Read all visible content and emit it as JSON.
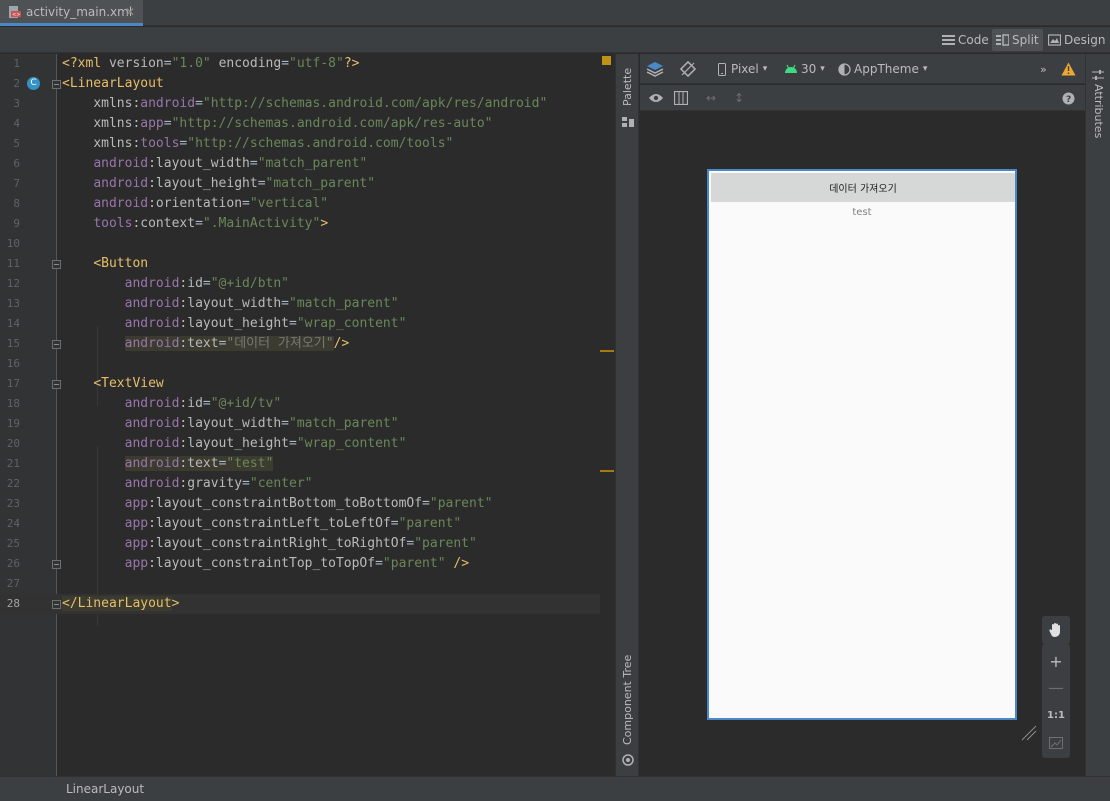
{
  "tab": {
    "filename": "activity_main.xml"
  },
  "modes": {
    "code": "Code",
    "split": "Split",
    "design": "Design",
    "active": "split"
  },
  "editor": {
    "current_line": 28,
    "lines": [
      {
        "n": "1",
        "parts": [
          [
            "c-tag",
            "<?xml "
          ],
          [
            "c-attr",
            "version"
          ],
          [
            "c-plain",
            "="
          ],
          [
            "c-str",
            "\"1.0\""
          ],
          [
            "c-plain",
            " "
          ],
          [
            "c-attr",
            "encoding"
          ],
          [
            "c-plain",
            "="
          ],
          [
            "c-str",
            "\"utf-8\""
          ],
          [
            "c-tag",
            "?>"
          ]
        ]
      },
      {
        "n": "2",
        "parts": [
          [
            "c-tag",
            "<LinearLayout"
          ]
        ]
      },
      {
        "n": "3",
        "parts": [
          [
            "c-plain",
            "    "
          ],
          [
            "c-attr",
            "xmlns:"
          ],
          [
            "c-ns",
            "android"
          ],
          [
            "c-plain",
            "="
          ],
          [
            "c-str",
            "\"http://schemas.android.com/apk/res/android\""
          ]
        ]
      },
      {
        "n": "4",
        "parts": [
          [
            "c-plain",
            "    "
          ],
          [
            "c-attr",
            "xmlns:"
          ],
          [
            "c-ns",
            "app"
          ],
          [
            "c-plain",
            "="
          ],
          [
            "c-str",
            "\"http://schemas.android.com/apk/res-auto\""
          ]
        ]
      },
      {
        "n": "5",
        "parts": [
          [
            "c-plain",
            "    "
          ],
          [
            "c-attr",
            "xmlns:"
          ],
          [
            "c-ns",
            "tools"
          ],
          [
            "c-plain",
            "="
          ],
          [
            "c-str",
            "\"http://schemas.android.com/tools\""
          ]
        ]
      },
      {
        "n": "6",
        "parts": [
          [
            "c-plain",
            "    "
          ],
          [
            "c-ns",
            "android"
          ],
          [
            "c-attr",
            ":layout_width"
          ],
          [
            "c-plain",
            "="
          ],
          [
            "c-str",
            "\"match_parent\""
          ]
        ]
      },
      {
        "n": "7",
        "parts": [
          [
            "c-plain",
            "    "
          ],
          [
            "c-ns",
            "android"
          ],
          [
            "c-attr",
            ":layout_height"
          ],
          [
            "c-plain",
            "="
          ],
          [
            "c-str",
            "\"match_parent\""
          ]
        ]
      },
      {
        "n": "8",
        "parts": [
          [
            "c-plain",
            "    "
          ],
          [
            "c-ns",
            "android"
          ],
          [
            "c-attr",
            ":orientation"
          ],
          [
            "c-plain",
            "="
          ],
          [
            "c-str",
            "\"vertical\""
          ]
        ]
      },
      {
        "n": "9",
        "parts": [
          [
            "c-plain",
            "    "
          ],
          [
            "c-ns",
            "tools"
          ],
          [
            "c-attr",
            ":context"
          ],
          [
            "c-plain",
            "="
          ],
          [
            "c-str",
            "\".MainActivity\""
          ],
          [
            "c-tag",
            ">"
          ]
        ]
      },
      {
        "n": "10",
        "parts": []
      },
      {
        "n": "11",
        "parts": [
          [
            "c-plain",
            "    "
          ],
          [
            "c-tag",
            "<Button"
          ]
        ]
      },
      {
        "n": "12",
        "parts": [
          [
            "c-plain",
            "        "
          ],
          [
            "c-ns",
            "android"
          ],
          [
            "c-attr",
            ":id"
          ],
          [
            "c-plain",
            "="
          ],
          [
            "c-str",
            "\"@+id/btn\""
          ]
        ]
      },
      {
        "n": "13",
        "parts": [
          [
            "c-plain",
            "        "
          ],
          [
            "c-ns",
            "android"
          ],
          [
            "c-attr",
            ":layout_width"
          ],
          [
            "c-plain",
            "="
          ],
          [
            "c-str",
            "\"match_parent\""
          ]
        ]
      },
      {
        "n": "14",
        "parts": [
          [
            "c-plain",
            "        "
          ],
          [
            "c-ns",
            "android"
          ],
          [
            "c-attr",
            ":layout_height"
          ],
          [
            "c-plain",
            "="
          ],
          [
            "c-str",
            "\"wrap_content\""
          ]
        ]
      },
      {
        "n": "15",
        "parts": [
          [
            "c-plain",
            "        "
          ],
          [
            "c-ns c-hl",
            "android"
          ],
          [
            "c-attr c-hl",
            ":text"
          ],
          [
            "c-plain c-hl",
            "="
          ],
          [
            "c-hint c-hl",
            "\"데이터 가져오기\""
          ],
          [
            "c-tag",
            "/>"
          ]
        ]
      },
      {
        "n": "16",
        "parts": []
      },
      {
        "n": "17",
        "parts": [
          [
            "c-plain",
            "    "
          ],
          [
            "c-tag",
            "<TextView"
          ]
        ]
      },
      {
        "n": "18",
        "parts": [
          [
            "c-plain",
            "        "
          ],
          [
            "c-ns",
            "android"
          ],
          [
            "c-attr",
            ":id"
          ],
          [
            "c-plain",
            "="
          ],
          [
            "c-str",
            "\"@+id/tv\""
          ]
        ]
      },
      {
        "n": "19",
        "parts": [
          [
            "c-plain",
            "        "
          ],
          [
            "c-ns",
            "android"
          ],
          [
            "c-attr",
            ":layout_width"
          ],
          [
            "c-plain",
            "="
          ],
          [
            "c-str",
            "\"match_parent\""
          ]
        ]
      },
      {
        "n": "20",
        "parts": [
          [
            "c-plain",
            "        "
          ],
          [
            "c-ns",
            "android"
          ],
          [
            "c-attr",
            ":layout_height"
          ],
          [
            "c-plain",
            "="
          ],
          [
            "c-str",
            "\"wrap_content\""
          ]
        ]
      },
      {
        "n": "21",
        "parts": [
          [
            "c-plain",
            "        "
          ],
          [
            "c-ns c-hl",
            "android"
          ],
          [
            "c-attr c-hl",
            ":text"
          ],
          [
            "c-plain c-hl",
            "="
          ],
          [
            "c-str c-hl",
            "\"test\""
          ]
        ]
      },
      {
        "n": "22",
        "parts": [
          [
            "c-plain",
            "        "
          ],
          [
            "c-ns",
            "android"
          ],
          [
            "c-attr",
            ":gravity"
          ],
          [
            "c-plain",
            "="
          ],
          [
            "c-str",
            "\"center\""
          ]
        ]
      },
      {
        "n": "23",
        "parts": [
          [
            "c-plain",
            "        "
          ],
          [
            "c-ns",
            "app"
          ],
          [
            "c-attr",
            ":layout_constraintBottom_toBottomOf"
          ],
          [
            "c-plain",
            "="
          ],
          [
            "c-str",
            "\"parent\""
          ]
        ]
      },
      {
        "n": "24",
        "parts": [
          [
            "c-plain",
            "        "
          ],
          [
            "c-ns",
            "app"
          ],
          [
            "c-attr",
            ":layout_constraintLeft_toLeftOf"
          ],
          [
            "c-plain",
            "="
          ],
          [
            "c-str",
            "\"parent\""
          ]
        ]
      },
      {
        "n": "25",
        "parts": [
          [
            "c-plain",
            "        "
          ],
          [
            "c-ns",
            "app"
          ],
          [
            "c-attr",
            ":layout_constraintRight_toRightOf"
          ],
          [
            "c-plain",
            "="
          ],
          [
            "c-str",
            "\"parent\""
          ]
        ]
      },
      {
        "n": "26",
        "parts": [
          [
            "c-plain",
            "        "
          ],
          [
            "c-ns",
            "app"
          ],
          [
            "c-attr",
            ":layout_constraintTop_toTopOf"
          ],
          [
            "c-plain",
            "="
          ],
          [
            "c-str",
            "\"parent\""
          ],
          [
            "c-plain",
            " "
          ],
          [
            "c-tag",
            "/>"
          ]
        ]
      },
      {
        "n": "27",
        "parts": []
      },
      {
        "n": "28",
        "parts": [
          [
            "c-tag c-hl",
            "</LinearLayout"
          ],
          [
            "c-tag",
            "> "
          ]
        ]
      }
    ]
  },
  "side_tabs": {
    "palette": "Palette",
    "component_tree": "Component Tree",
    "attributes": "Attributes"
  },
  "design_toolbar": {
    "device": "Pixel",
    "api": "30",
    "theme": "AppTheme"
  },
  "preview": {
    "button_text": "데이터 가져오기",
    "textview_text": "test"
  },
  "zoom": {
    "one_to_one": "1:1"
  },
  "status": {
    "breadcrumb": "LinearLayout"
  },
  "colors": {
    "accent": "#4a88c7",
    "warning": "#f0a732",
    "android_green": "#3ddc84"
  },
  "icons": [
    "xml-file-icon",
    "close-icon",
    "lines-icon",
    "split-icon",
    "image-icon",
    "layers-icon",
    "rotate-icon",
    "phone-icon",
    "android-icon",
    "theme-icon",
    "chevron-down-icon",
    "more-icon",
    "warning-icon",
    "eye-icon",
    "blueprint-icon",
    "horizontal-arrows-icon",
    "vertical-arrows-icon",
    "help-icon",
    "hand-icon",
    "plus-icon",
    "minus-icon",
    "fit-screen-icon",
    "resize-icon"
  ]
}
